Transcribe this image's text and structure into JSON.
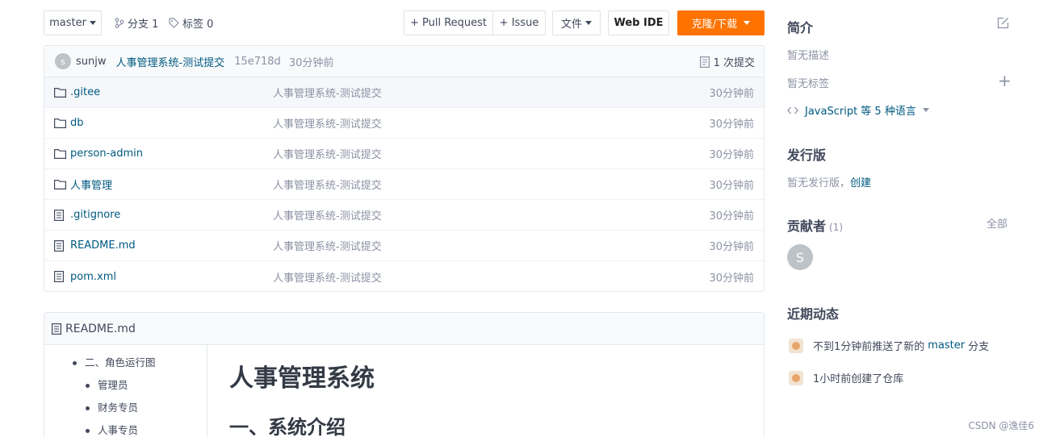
{
  "toolbar": {
    "branch": "master",
    "branches": "分支 1",
    "tags": "标签 0",
    "pull_request": "+ Pull Request",
    "issue": "+ Issue",
    "file": "文件",
    "web_ide": "Web IDE",
    "clone": "克隆/下载"
  },
  "commit": {
    "avatar_letter": "s",
    "author": "sunjw",
    "message": "人事管理系统-测试提交",
    "hash": "15e718d",
    "time": "30分钟前",
    "count": "1 次提交"
  },
  "files": [
    {
      "type": "folder",
      "name": ".gitee",
      "message": "人事管理系统-测试提交",
      "time": "30分钟前"
    },
    {
      "type": "folder",
      "name": "db",
      "message": "人事管理系统-测试提交",
      "time": "30分钟前"
    },
    {
      "type": "folder",
      "name": "person-admin",
      "message": "人事管理系统-测试提交",
      "time": "30分钟前"
    },
    {
      "type": "folder",
      "name": "人事管理",
      "message": "人事管理系统-测试提交",
      "time": "30分钟前"
    },
    {
      "type": "file",
      "name": ".gitignore",
      "message": "人事管理系统-测试提交",
      "time": "30分钟前"
    },
    {
      "type": "file",
      "name": "README.md",
      "message": "人事管理系统-测试提交",
      "time": "30分钟前"
    },
    {
      "type": "file",
      "name": "pom.xml",
      "message": "人事管理系统-测试提交",
      "time": "30分钟前"
    }
  ],
  "readme": {
    "filename": "README.md",
    "toc": [
      {
        "level": 1,
        "text": "二、角色运行图"
      },
      {
        "level": 2,
        "text": "管理员"
      },
      {
        "level": 2,
        "text": "财务专员"
      },
      {
        "level": 2,
        "text": "人事专员"
      }
    ],
    "h1": "人事管理系统",
    "h2": "一、系统介绍"
  },
  "sidebar": {
    "intro_title": "简介",
    "no_description": "暂无描述",
    "no_tags": "暂无标签",
    "languages": "JavaScript 等 5 种语言",
    "releases_title": "发行版",
    "no_releases": "暂无发行版，",
    "create": "创建",
    "contributors_title": "贡献者",
    "contributors_count": "(1)",
    "all": "全部",
    "contributor_letter": "S",
    "activity_title": "近期动态",
    "activity_1_prefix": "不到1分钟前推送了新的",
    "activity_1_branch": "master",
    "activity_1_suffix": "分支",
    "activity_2": "1小时前创建了仓库"
  },
  "watermark": "CSDN @逸佳6",
  "colors": {
    "accent": "#fe7300",
    "link": "#005980",
    "muted": "#8c92a4"
  }
}
